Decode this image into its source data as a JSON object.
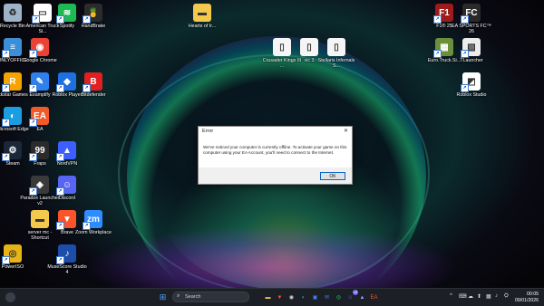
{
  "desktop": {
    "icons": [
      {
        "label": "Recycle Bin",
        "icon": "recycle-bin-icon",
        "color": "#9fb3c8"
      },
      {
        "label": "American Truck Si...",
        "icon": "ats-icon",
        "color": "#ffffff"
      },
      {
        "label": "Spotify",
        "icon": "spotify-icon",
        "color": "#1db954"
      },
      {
        "label": "HandBrake",
        "icon": "handbrake-icon",
        "color": "#2b2b2b"
      },
      {
        "label": "Hearts of Ir...",
        "icon": "folder-icon",
        "color": "#f2c94c"
      },
      {
        "label": "F1® 25",
        "icon": "f1-icon",
        "color": "#9c1c1c"
      },
      {
        "label": "EA SPORTS FC™ 26",
        "icon": "fc26-icon",
        "color": "#2a2a2a"
      },
      {
        "label": "ONLYOFFICE",
        "icon": "onlyoffice-icon",
        "color": "#3b8fd6"
      },
      {
        "label": "Google Chrome",
        "icon": "chrome-icon",
        "color": "#ea4335"
      },
      {
        "label": "Crusader Kings III ...",
        "icon": "file-icon",
        "color": "#f5f5f5"
      },
      {
        "label": "vic 3",
        "icon": "file-icon",
        "color": "#f5f5f5"
      },
      {
        "label": "Stellaris Infernals S...",
        "icon": "file-icon",
        "color": "#f5f5f5"
      },
      {
        "label": "Euro.Truck.Si...",
        "icon": "ets2-icon",
        "color": "#6b8f3a"
      },
      {
        "label": "TLauncher",
        "icon": "tlauncher-icon",
        "color": "#ececec"
      },
      {
        "label": "Rockstar Games ...",
        "icon": "rockstar-icon",
        "color": "#f5a300"
      },
      {
        "label": "Examplify",
        "icon": "examplify-icon",
        "color": "#2f80ed"
      },
      {
        "label": "Roblox Player",
        "icon": "roblox-player-icon",
        "color": "#1e6fe0"
      },
      {
        "label": "Bitdefender",
        "icon": "bitdefender-icon",
        "color": "#e02020"
      },
      {
        "label": "Roblox Studio",
        "icon": "roblox-studio-icon",
        "color": "#ffffff"
      },
      {
        "label": "Microsoft Edge",
        "icon": "edge-icon",
        "color": "#1b9de2"
      },
      {
        "label": "EA",
        "icon": "ea-icon",
        "color": "#f15a29"
      },
      {
        "label": "Steam",
        "icon": "steam-icon",
        "color": "#1b2838"
      },
      {
        "label": "Fraps",
        "icon": "fraps-icon",
        "color": "#2b2b2b"
      },
      {
        "label": "NordVPN",
        "icon": "nordvpn-icon",
        "color": "#3e5fff"
      },
      {
        "label": "Paradox Launcher v2",
        "icon": "paradox-icon",
        "color": "#3a3a3a"
      },
      {
        "label": "Discord",
        "icon": "discord-icon",
        "color": "#5865f2"
      },
      {
        "label": "server mc - Shortcut",
        "icon": "folder-icon",
        "color": "#f2c94c"
      },
      {
        "label": "Brave",
        "icon": "brave-icon",
        "color": "#fb542b"
      },
      {
        "label": "Zoom Workplace",
        "icon": "zoom-icon",
        "color": "#2d8cff"
      },
      {
        "label": "PowerISO",
        "icon": "poweriso-icon",
        "color": "#e7b416"
      },
      {
        "label": "MuseScore Studio 4",
        "icon": "musescore-icon",
        "color": "#1a4ea8"
      }
    ]
  },
  "dialog": {
    "title": "Error",
    "close_glyph": "✕",
    "message": "We've noticed your computer is currently offline. To activate your game on this computer using your EA Account, you'll need to connect to the Internet.",
    "ok_label": "OK"
  },
  "taskbar": {
    "search_placeholder": "Search",
    "start_glyph": "⊞",
    "pinned": [
      {
        "icon": "file-explorer-icon",
        "glyph": "▬",
        "color": "#f2c94c"
      },
      {
        "icon": "brave-icon",
        "glyph": "▼",
        "color": "#fb542b"
      },
      {
        "icon": "steam-icon",
        "glyph": "◉",
        "color": "#c7d5e0"
      },
      {
        "icon": "edge-icon",
        "glyph": "◐",
        "color": "#1b9de2"
      },
      {
        "icon": "store-icon",
        "glyph": "▣",
        "color": "#3b82f6"
      },
      {
        "icon": "mail-icon",
        "glyph": "✉",
        "color": "#3b82f6"
      },
      {
        "icon": "whatsapp-icon",
        "glyph": "◎",
        "color": "#25d366"
      },
      {
        "icon": "discord-icon",
        "glyph": "☺",
        "color": "#5865f2"
      },
      {
        "icon": "nordvpn-icon",
        "glyph": "▲",
        "color": "#8fa3ff"
      },
      {
        "icon": "ea-app-icon",
        "glyph": "EA",
        "color": "#f15a29"
      }
    ],
    "discord_badge": "10",
    "tray_glyphs": [
      "^",
      "⌨",
      "☁",
      "⬆",
      "▦",
      "♪",
      "⛭"
    ],
    "time": "00:05",
    "date": "09/01/2026"
  }
}
